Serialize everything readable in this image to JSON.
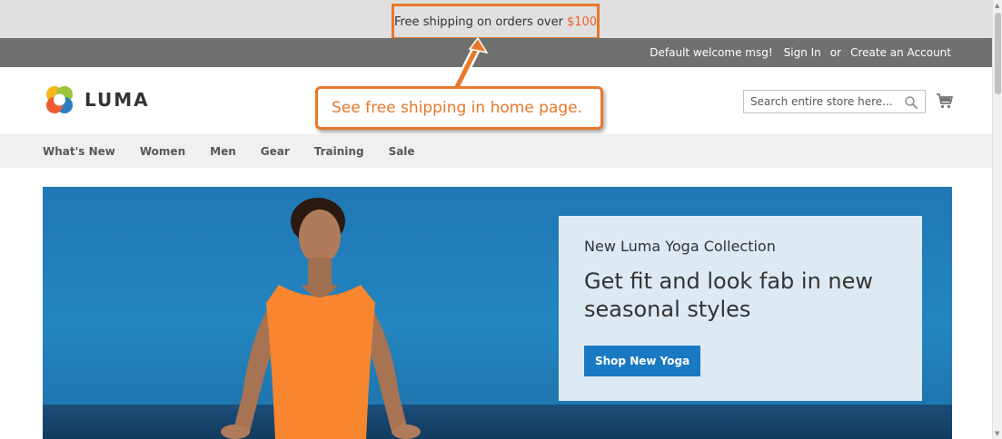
{
  "promo": {
    "text": "Free shipping on orders over",
    "amount": "$100",
    "accent_color": "#e8622c"
  },
  "header": {
    "welcome": "Default welcome msg!",
    "sign_in": "Sign In",
    "or": "or",
    "create_account": "Create an Account"
  },
  "logo": {
    "text": "LUMA",
    "icon": "luma-logo-icon"
  },
  "annotation": {
    "callout_text": "See free shipping in home page.",
    "color": "#e8782a"
  },
  "search": {
    "placeholder": "Search entire store here...",
    "icon": "search-icon"
  },
  "cart": {
    "icon": "cart-icon"
  },
  "nav": {
    "items": [
      "What's New",
      "Women",
      "Men",
      "Gear",
      "Training",
      "Sale"
    ]
  },
  "hero": {
    "subtitle": "New Luma Yoga Collection",
    "title": "Get fit and look fab in new seasonal styles",
    "button": "Shop New Yoga",
    "button_color": "#1979c3"
  }
}
